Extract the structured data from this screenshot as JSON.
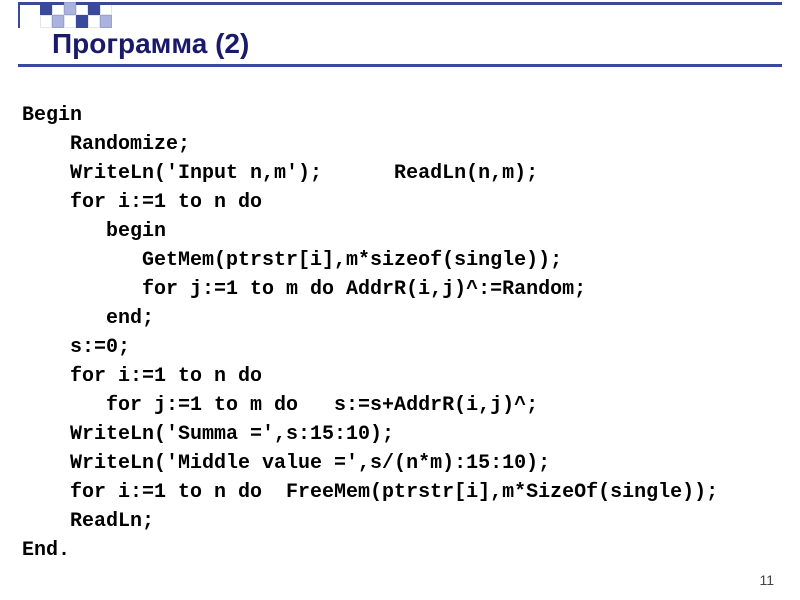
{
  "slide": {
    "title": "Программа (2)",
    "page_number": "11"
  },
  "code": {
    "lines": [
      "Begin",
      "    Randomize;",
      "    WriteLn('Input n,m');      ReadLn(n,m);",
      "    for i:=1 to n do",
      "       begin",
      "          GetMem(ptrstr[i],m*sizeof(single));",
      "          for j:=1 to m do AddrR(i,j)^:=Random;",
      "       end;",
      "    s:=0;",
      "    for i:=1 to n do",
      "       for j:=1 to m do   s:=s+AddrR(i,j)^;",
      "    WriteLn('Summa =',s:15:10);",
      "    WriteLn('Middle value =',s/(n*m):15:10);",
      "    for i:=1 to n do  FreeMem(ptrstr[i],m*SizeOf(single));",
      "    ReadLn;",
      "End."
    ]
  }
}
